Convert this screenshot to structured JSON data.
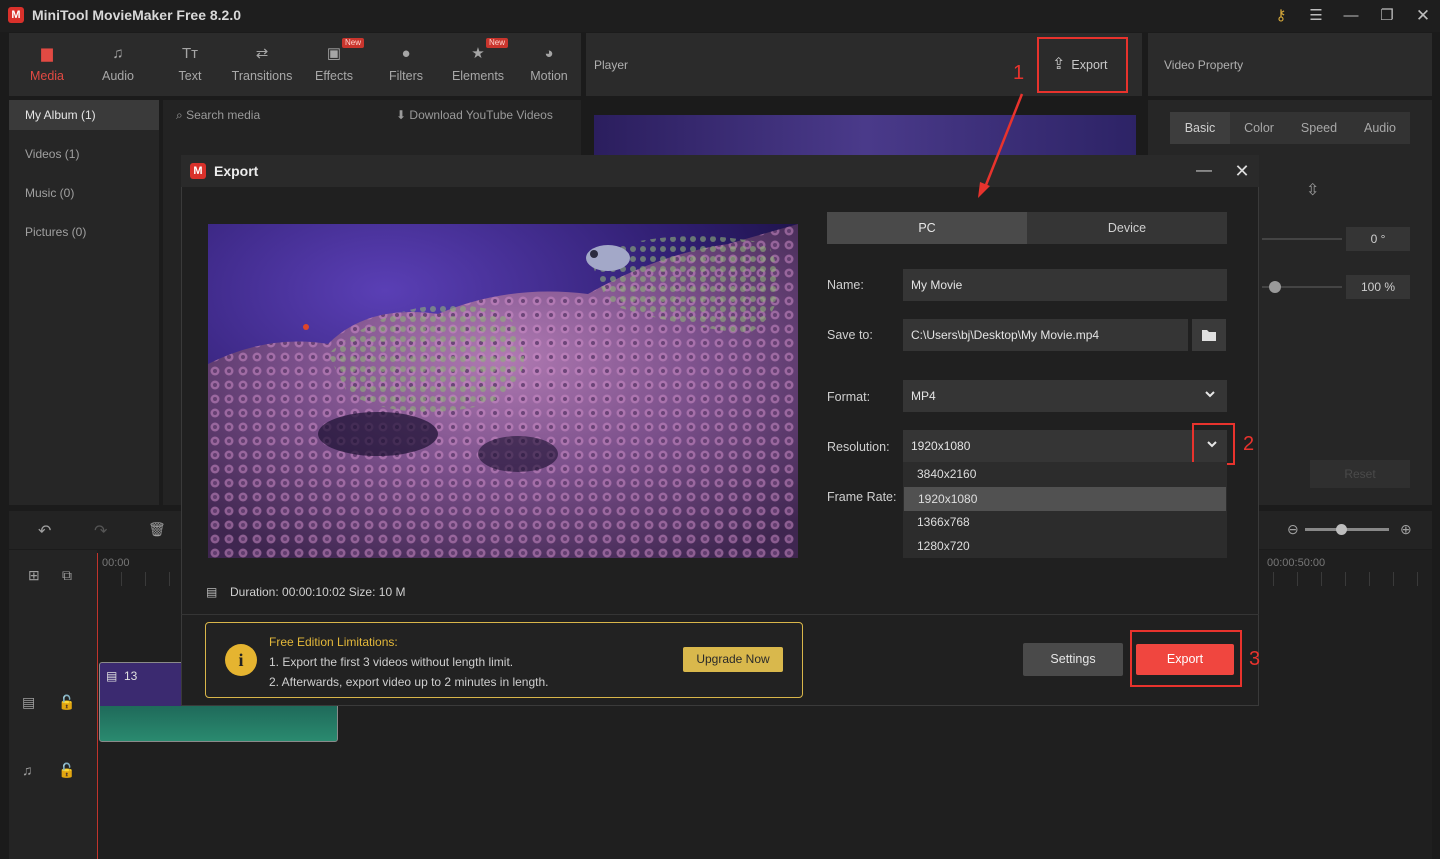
{
  "window": {
    "title": "MiniTool MovieMaker Free 8.2.0",
    "logo_letter": "M"
  },
  "toolbar": {
    "items": [
      {
        "label": "Media",
        "icon": "folder-icon"
      },
      {
        "label": "Audio",
        "icon": "music-note-icon"
      },
      {
        "label": "Text",
        "icon": "text-icon"
      },
      {
        "label": "Transitions",
        "icon": "transitions-icon"
      },
      {
        "label": "Effects",
        "icon": "effects-icon",
        "badge": "New"
      },
      {
        "label": "Filters",
        "icon": "filters-icon"
      },
      {
        "label": "Elements",
        "icon": "elements-icon",
        "badge": "New"
      },
      {
        "label": "Motion",
        "icon": "motion-icon"
      }
    ]
  },
  "album": {
    "items": [
      "My Album (1)",
      "Videos (1)",
      "Music (0)",
      "Pictures (0)"
    ],
    "search_placeholder": "Search media",
    "download_label": "Download YouTube Videos"
  },
  "player": {
    "label": "Player",
    "export_label": "Export"
  },
  "video_property": {
    "label": "Video Property",
    "tabs": [
      "Basic",
      "Color",
      "Speed",
      "Audio"
    ],
    "rotation": "0 °",
    "scale": "100 %",
    "reset_label": "Reset"
  },
  "timeline": {
    "start_time": "00:00",
    "end_time": "00:00:50:00",
    "clip_number": "13"
  },
  "dialog": {
    "title": "Export",
    "tabs": [
      "PC",
      "Device"
    ],
    "name_label": "Name:",
    "name_value": "My Movie",
    "save_label": "Save to:",
    "save_value": "C:\\Users\\bj\\Desktop\\My Movie.mp4",
    "format_label": "Format:",
    "format_value": "MP4",
    "resolution_label": "Resolution:",
    "resolution_value": "1920x1080",
    "resolution_options": [
      "3840x2160",
      "1920x1080",
      "1366x768",
      "1280x720"
    ],
    "resolution_selected": "1920x1080",
    "framerate_label": "Frame Rate:",
    "duration_text": "Duration:  00:00:10:02  Size:  10 M",
    "limits": {
      "title": "Free Edition Limitations:",
      "line1": "1. Export the first 3 videos without length limit.",
      "line2": "2. Afterwards, export video up to 2 minutes in length."
    },
    "upgrade_label": "Upgrade Now",
    "settings_label": "Settings",
    "export_label": "Export"
  },
  "annotations": {
    "n1": "1",
    "n2": "2",
    "n3": "3"
  },
  "colors": {
    "accent": "#f0463f",
    "annotation": "#e8332d",
    "upgrade": "#d9b84c"
  }
}
